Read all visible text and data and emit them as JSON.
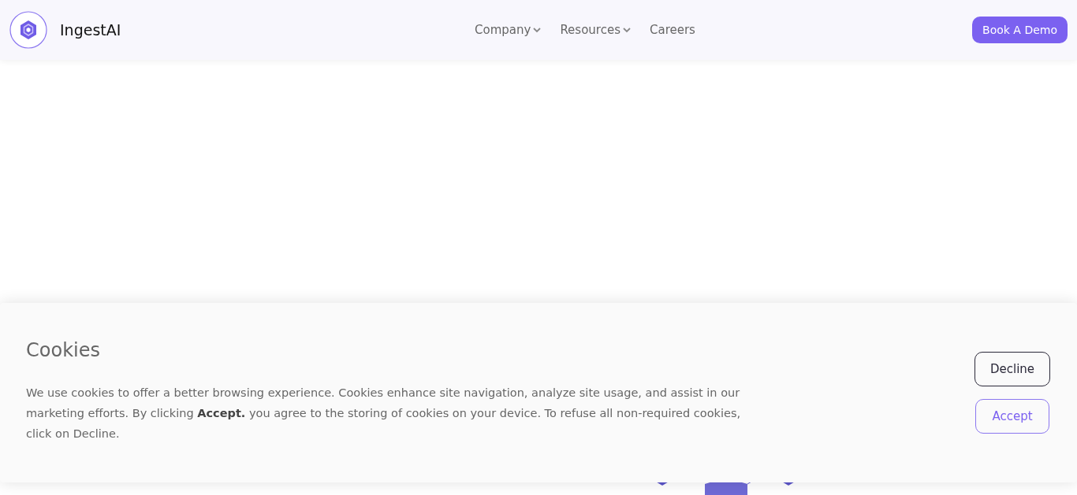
{
  "header": {
    "brand": "IngestAI",
    "nav": [
      {
        "label": "Company",
        "kind": "dropdown"
      },
      {
        "label": "Resources",
        "kind": "dropdown"
      },
      {
        "label": "Careers",
        "kind": "link"
      }
    ],
    "cta": "Book A Demo"
  },
  "cookie_banner": {
    "title": "Cookies",
    "text": "We use cookies to offer a better browsing experience. Cookies enhance site navigation, analyze site usage, and assist in our marketing efforts. By clicking **Accept.** you agree to the storing of cookies on your device. To refuse all non-required cookies, click on Decline.",
    "buttons": [
      {
        "label": "Decline",
        "kind": "secondary"
      },
      {
        "label": "Accept",
        "kind": "primary"
      }
    ]
  }
}
